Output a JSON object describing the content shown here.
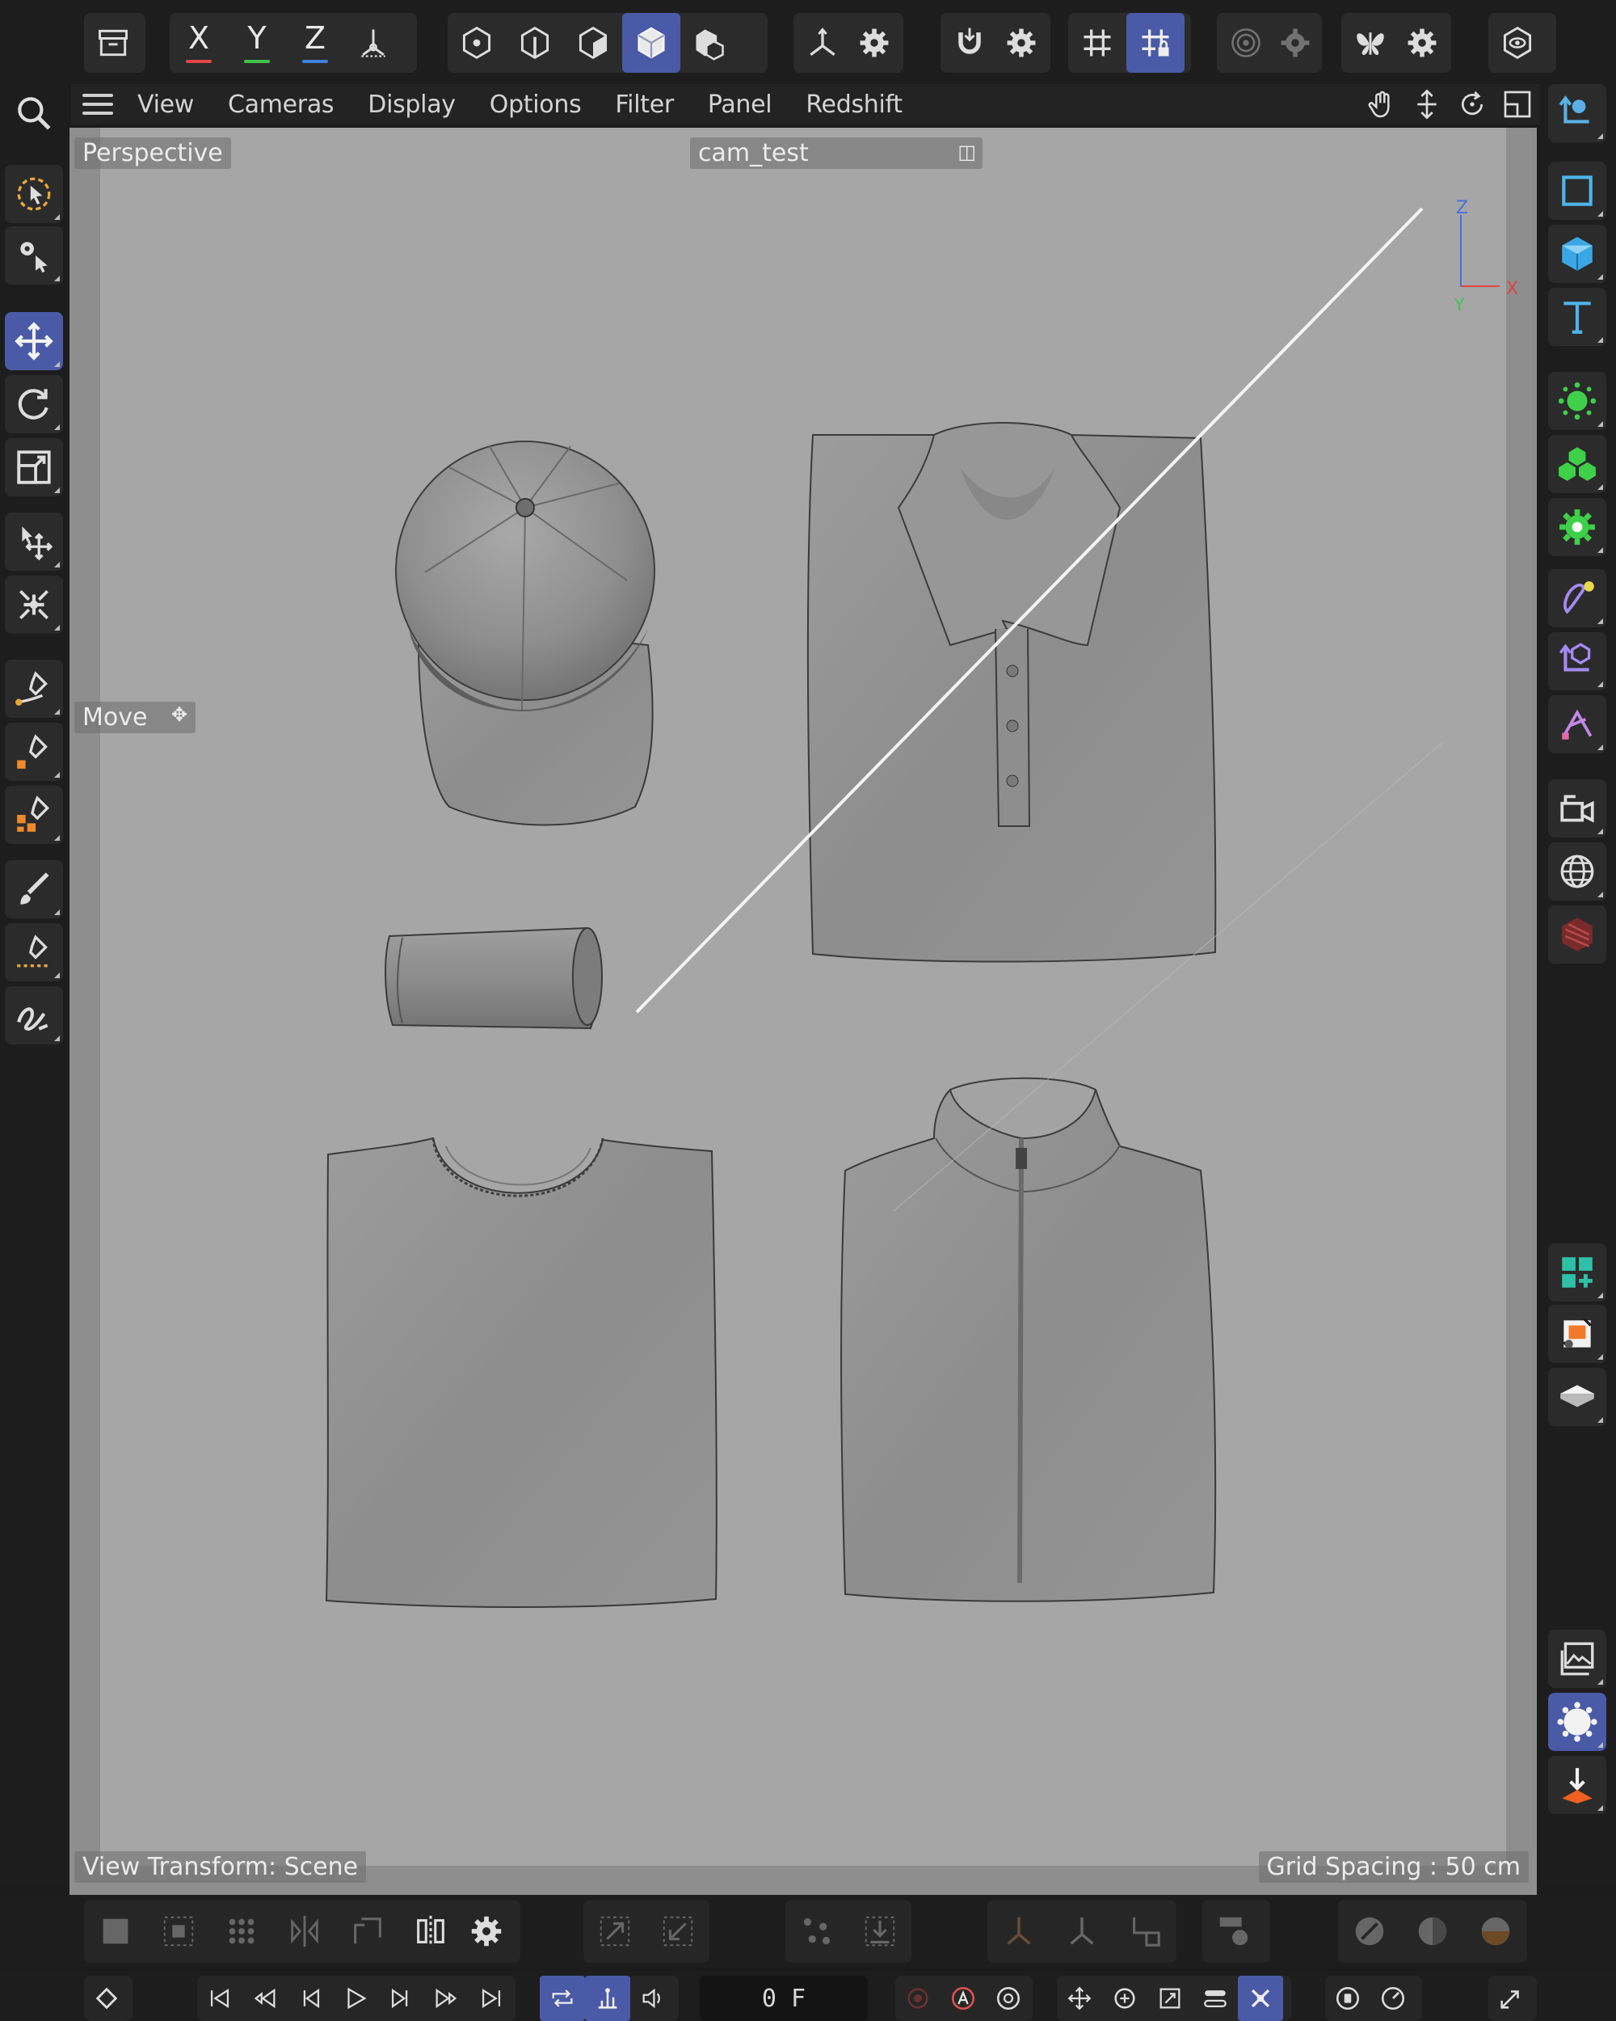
{
  "menubar": {
    "items": [
      "View",
      "Cameras",
      "Display",
      "Options",
      "Filter",
      "Panel",
      "Redshift"
    ]
  },
  "top_toolbar": {
    "axis_x": "X",
    "axis_y": "Y",
    "axis_z": "Z",
    "axis_colors": {
      "x": "#e24545",
      "y": "#41c24b",
      "z": "#3f7fe0"
    },
    "accent_color": "#4a5aa6"
  },
  "viewport": {
    "view_name": "Perspective",
    "camera_name": "cam_test",
    "active_tool_label": "Move",
    "view_transform": "View Transform: Scene",
    "grid_spacing": "Grid Spacing : 50 cm",
    "gizmo": {
      "z": "Z",
      "x": "X",
      "y": "Y"
    }
  },
  "timeline": {
    "current_frame": "0 F"
  }
}
